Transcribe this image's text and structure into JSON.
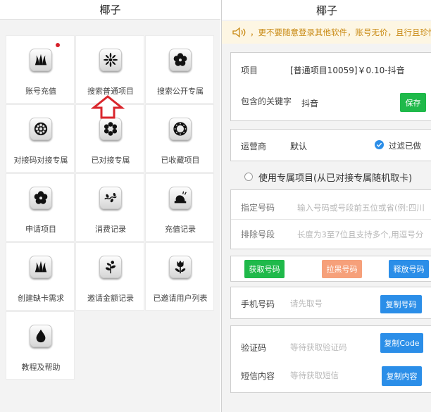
{
  "left": {
    "title": "椰子",
    "items": [
      {
        "label": "账号充值",
        "icon": "grass-icon"
      },
      {
        "label": "搜索普通项目",
        "icon": "burst-flower-icon"
      },
      {
        "label": "搜索公开专属",
        "icon": "flower-icon"
      },
      {
        "label": "对接码对接专属",
        "icon": "ornament-flower-icon"
      },
      {
        "label": "已对接专属",
        "icon": "daisy-icon"
      },
      {
        "label": "已收藏项目",
        "icon": "wreath-icon"
      },
      {
        "label": "申请项目",
        "icon": "flower-icon"
      },
      {
        "label": "消费记录",
        "icon": "vine-icon"
      },
      {
        "label": "充值记录",
        "icon": "snail-icon"
      },
      {
        "label": "创建缺卡需求",
        "icon": "grass-icon"
      },
      {
        "label": "邀请金额记录",
        "icon": "plant-icon"
      },
      {
        "label": "已邀请用户列表",
        "icon": "tulip-icon"
      },
      {
        "label": "教程及帮助",
        "icon": "drop-icon"
      }
    ]
  },
  "right": {
    "title": "椰子",
    "notice": "，更不要随意登录其他软件，账号无价，且行且珍惜",
    "project": {
      "label": "项目",
      "value": "[普通项目10059]￥0.10-抖音"
    },
    "keyword": {
      "label": "包含的关键字",
      "value": "抖音",
      "save": "保存"
    },
    "operator": {
      "label": "运营商",
      "value": "默认",
      "filter": "过滤已做"
    },
    "exclusive": {
      "label": "使用专属项目(从已对接专属随机取卡)"
    },
    "specify": {
      "label": "指定号码",
      "placeholder": "输入号码或号段前五位或省(例:四川"
    },
    "exclude": {
      "label": "排除号段",
      "placeholder": "长度为3至7位且支持多个,用逗号分"
    },
    "actions": {
      "get": "获取号码",
      "block": "拉黑号码",
      "release": "释放号码"
    },
    "phone": {
      "label": "手机号码",
      "placeholder": "请先取号",
      "copy": "复制号码"
    },
    "code": {
      "label": "验证码",
      "placeholder": "等待获取验证码",
      "copy": "复制Code"
    },
    "sms": {
      "label": "短信内容",
      "placeholder": "等待获取短信",
      "copy": "复制内容"
    }
  }
}
